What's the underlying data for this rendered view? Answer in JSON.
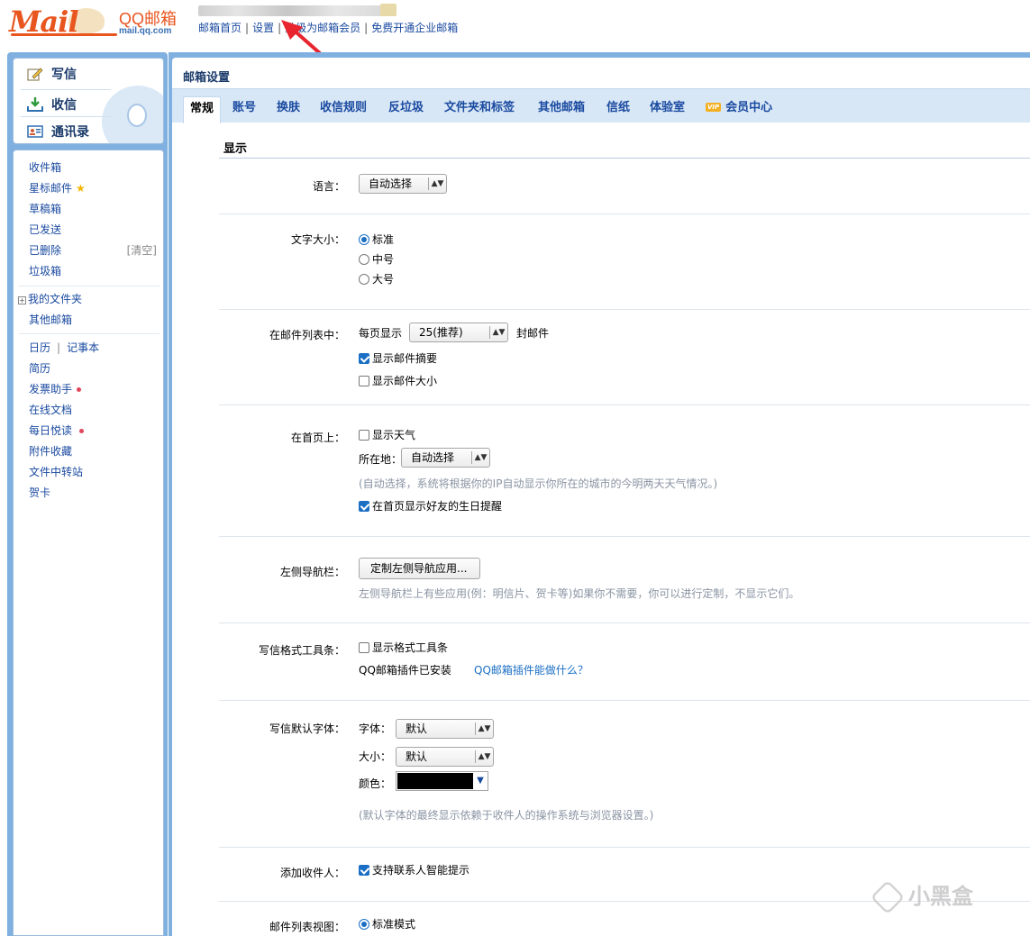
{
  "header": {
    "logo_wordmark": "Mail",
    "logo_brand": "QQ邮箱",
    "logo_url": "mail.qq.com",
    "links": [
      "邮箱首页",
      "设置",
      "升级为邮箱会员",
      "免费开通企业邮箱"
    ]
  },
  "sidebar": {
    "actions": [
      {
        "label": "写信",
        "icon": "compose-icon"
      },
      {
        "label": "收信",
        "icon": "inbox-download-icon"
      },
      {
        "label": "通讯录",
        "icon": "contacts-icon"
      }
    ],
    "folders": [
      "收件箱",
      "星标邮件",
      "草稿箱",
      "已发送",
      "已删除",
      "垃圾箱"
    ],
    "clear_label": "[清空]",
    "my_folders": "我的文件夹",
    "other_mailbox": "其他邮箱",
    "calendar": "日历",
    "notebook": "记事本",
    "apps": [
      "简历",
      "发票助手",
      "在线文档",
      "每日悦读",
      "附件收藏",
      "文件中转站",
      "贺卡"
    ]
  },
  "main": {
    "title": "邮箱设置",
    "tabs": [
      "常规",
      "账号",
      "换肤",
      "收信规则",
      "反垃圾",
      "文件夹和标签",
      "其他邮箱",
      "信纸",
      "体验室",
      "会员中心"
    ],
    "vip_badge": "VIP",
    "section_title": "显示"
  },
  "settings": {
    "language": {
      "label": "语言：",
      "value": "自动选择"
    },
    "font_size": {
      "label": "文字大小：",
      "options": [
        "标准",
        "中号",
        "大号"
      ],
      "selected": "标准"
    },
    "list": {
      "label": "在邮件列表中：",
      "per_page_prefix": "每页显示",
      "per_page_value": "25(推荐)",
      "per_page_suffix": "封邮件",
      "show_summary": "显示邮件摘要",
      "show_size": "显示邮件大小"
    },
    "home": {
      "label": "在首页上：",
      "show_weather": "显示天气",
      "location_label": "所在地：",
      "location_value": "自动选择",
      "hint": "(自动选择，系统将根据你的IP自动显示你所在的城市的今明两天天气情况。)",
      "birthday": "在首页显示好友的生日提醒"
    },
    "nav": {
      "label": "左侧导航栏：",
      "button": "定制左侧导航应用...",
      "hint": "左侧导航栏上有些应用(例：明信片、贺卡等)如果你不需要，你可以进行定制，不显示它们。"
    },
    "toolbar": {
      "label": "写信格式工具条：",
      "show_toolbar": "显示格式工具条",
      "plugin_status": "QQ邮箱插件已安装",
      "plugin_link": "QQ邮箱插件能做什么？"
    },
    "font": {
      "label": "写信默认字体：",
      "family_label": "字体：",
      "family_value": "默认",
      "size_label": "大小：",
      "size_value": "默认",
      "color_label": "颜色：",
      "color_value": "#000000",
      "hint": "(默认字体的最终显示依赖于收件人的操作系统与浏览器设置。)"
    },
    "recipients": {
      "label": "添加收件人：",
      "smart_hint": "支持联系人智能提示"
    },
    "list_view": {
      "label": "邮件列表视图：",
      "standard": "标准模式"
    }
  },
  "watermark": "小黑盒",
  "colors": {
    "accent": "#1a6fc4",
    "frame": "#7fb0e0",
    "tabbar": "#d8e7f6",
    "logo": "#e8551f"
  }
}
